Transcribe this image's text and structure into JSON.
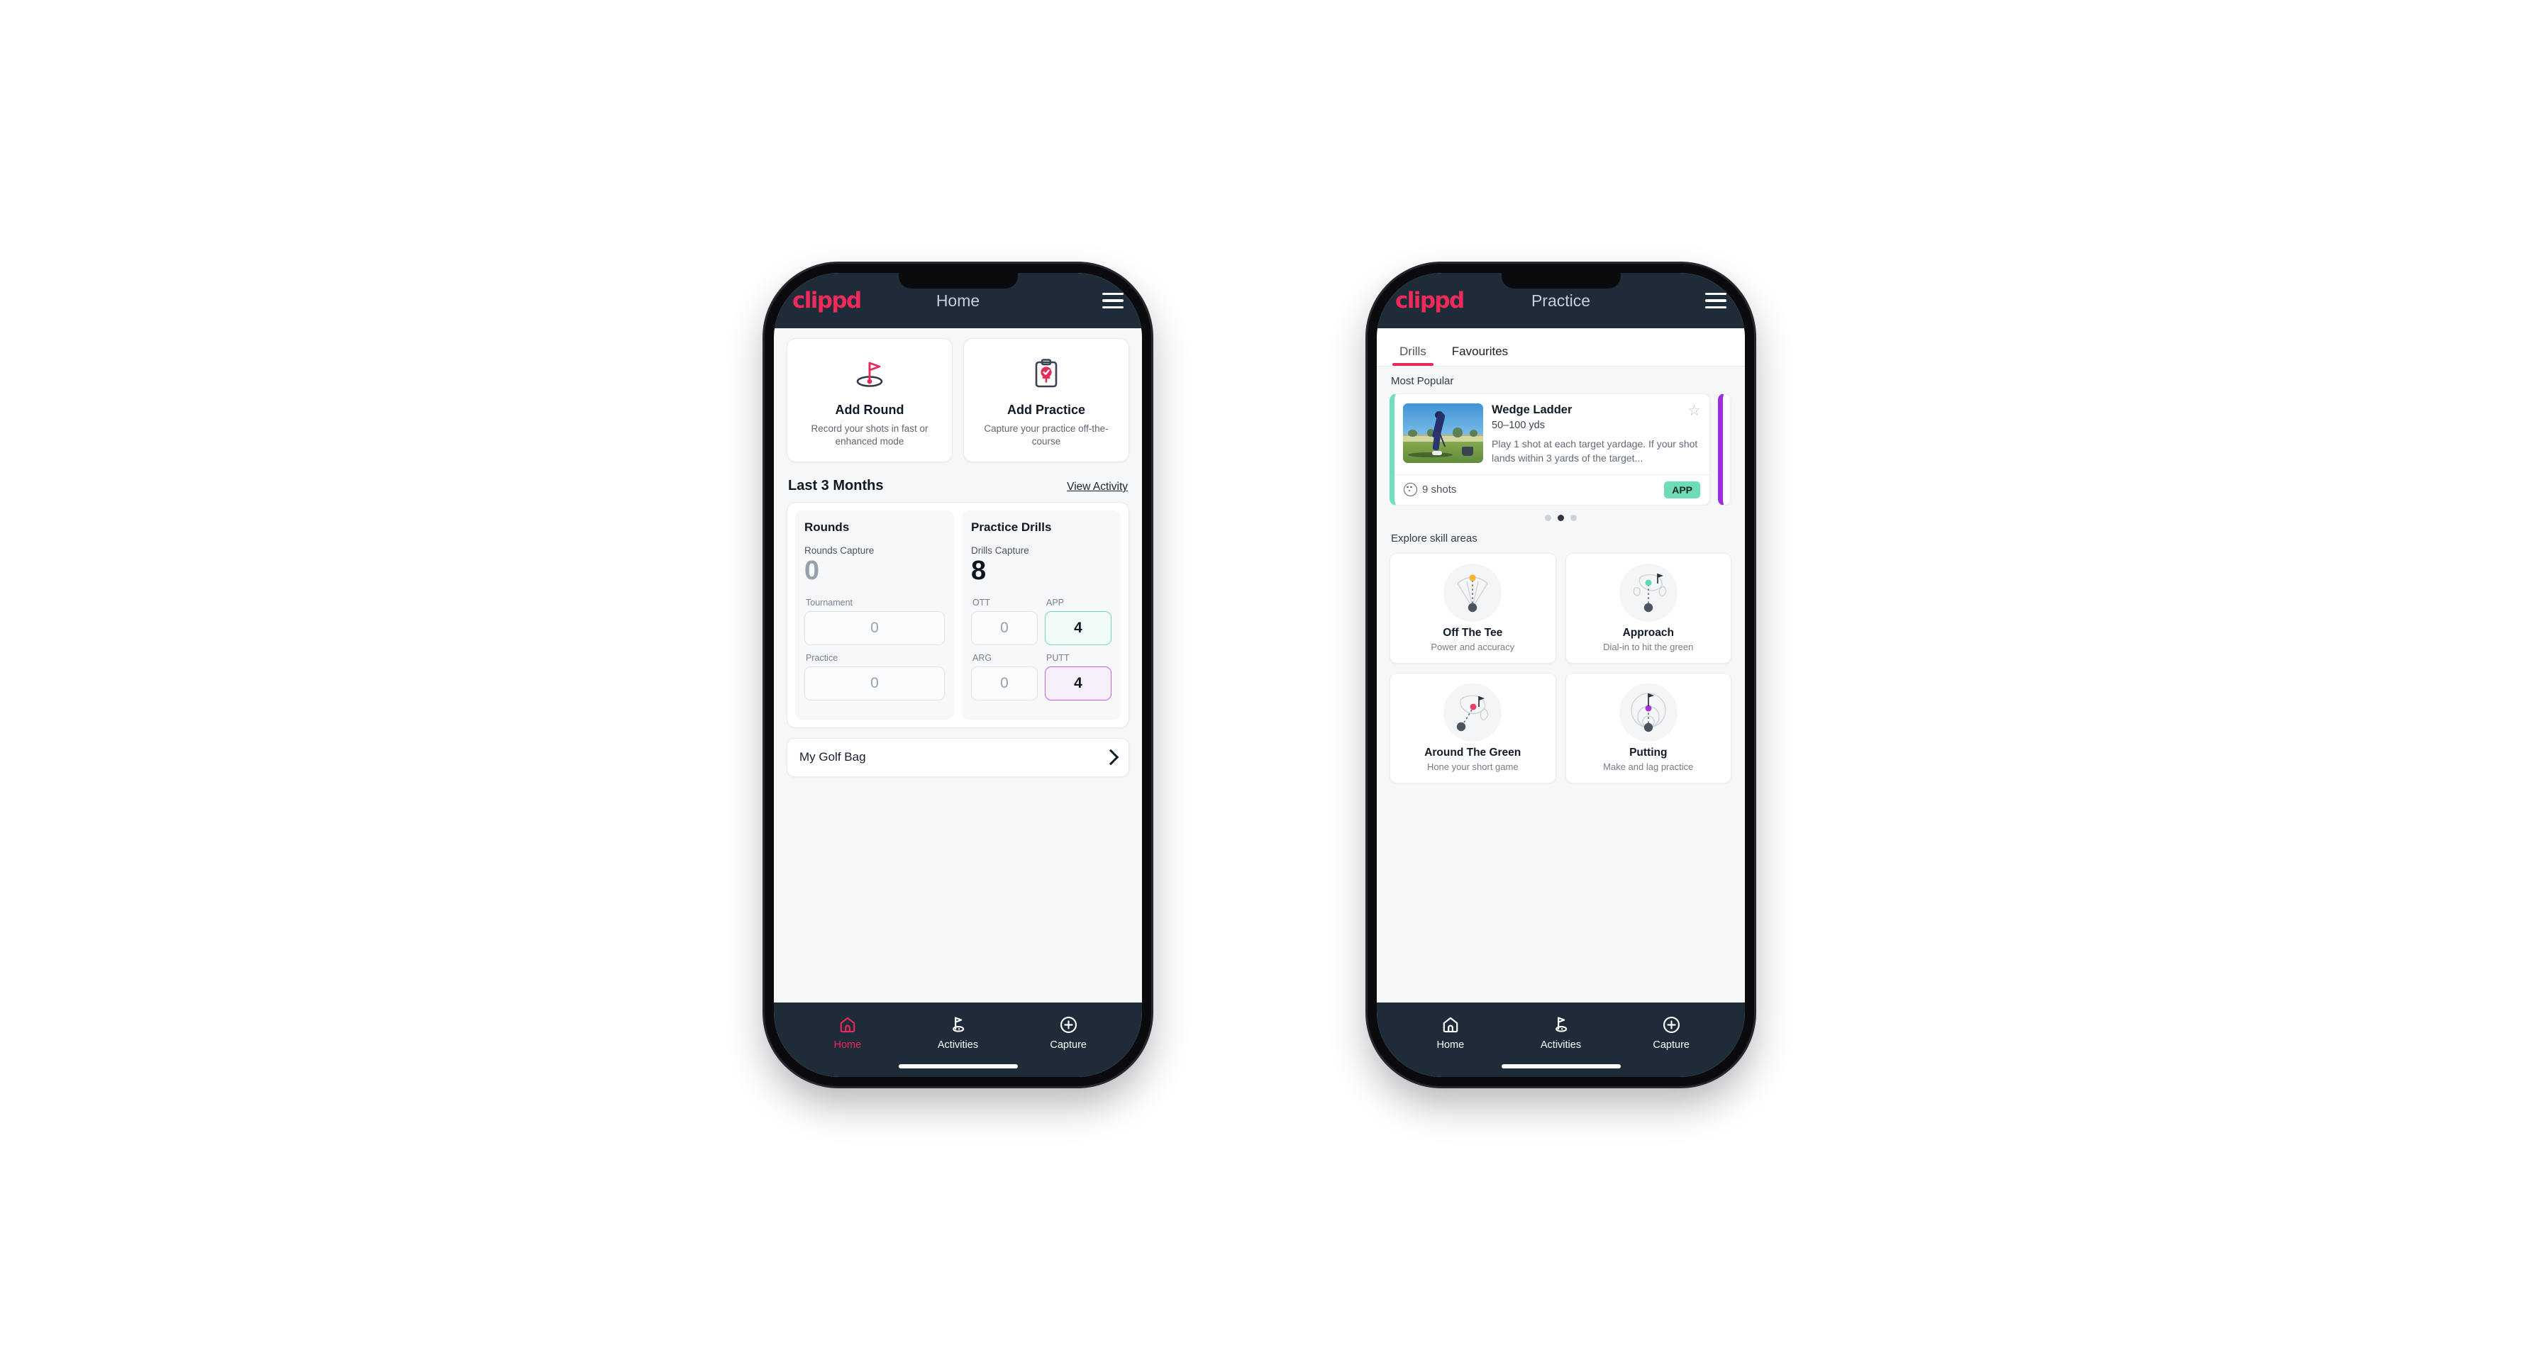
{
  "brand": "clippd",
  "phone_home": {
    "appbar": {
      "title": "Home",
      "menu_icon": "hamburger-menu-icon"
    },
    "quick_actions": [
      {
        "icon": "golf-flag-hole-icon",
        "title": "Add Round",
        "subtitle": "Record your shots in fast or enhanced mode"
      },
      {
        "icon": "clipboard-check-icon",
        "title": "Add Practice",
        "subtitle": "Capture your practice off-the-course"
      }
    ],
    "period": {
      "title": "Last 3 Months",
      "link": "View Activity"
    },
    "stats": {
      "rounds": {
        "heading": "Rounds",
        "capture_label": "Rounds Capture",
        "capture_value": "0",
        "fields": [
          {
            "label": "Tournament",
            "value": "0",
            "state": "empty"
          },
          {
            "label": "Practice",
            "value": "0",
            "state": "empty"
          }
        ]
      },
      "drills": {
        "heading": "Practice Drills",
        "capture_label": "Drills Capture",
        "capture_value": "8",
        "fields": [
          {
            "label": "OTT",
            "value": "0",
            "state": "empty"
          },
          {
            "label": "APP",
            "value": "4",
            "state": "app"
          },
          {
            "label": "ARG",
            "value": "0",
            "state": "empty"
          },
          {
            "label": "PUTT",
            "value": "4",
            "state": "putt"
          }
        ]
      }
    },
    "golf_bag": {
      "label": "My Golf Bag",
      "chevron_icon": "chevron-right-icon"
    },
    "bottom_nav": [
      {
        "label": "Home",
        "icon": "home-icon",
        "state": "active"
      },
      {
        "label": "Activities",
        "icon": "golf-flag-icon",
        "state": "default"
      },
      {
        "label": "Capture",
        "icon": "plus-circle-icon",
        "state": "default"
      }
    ]
  },
  "phone_practice": {
    "appbar": {
      "title": "Practice",
      "menu_icon": "hamburger-menu-icon"
    },
    "tabs": [
      {
        "label": "Drills",
        "active": true
      },
      {
        "label": "Favourites",
        "active": false
      }
    ],
    "most_popular_label": "Most Popular",
    "drill": {
      "title": "Wedge Ladder",
      "yardage": "50–100 yds",
      "description": "Play 1 shot at each target yardage. If your shot lands within 3 yards of the target...",
      "shots": "9 shots",
      "shots_icon": "golf-ball-icon",
      "tag": "APP",
      "star_icon": "star-outline-icon",
      "accent": "#6ee0bd",
      "next_accent": "#9d2ee0",
      "thumbnail_alt": "golfer-hitting-wedge-photo"
    },
    "carousel_dots": {
      "count": 3,
      "active_index": 1
    },
    "skill_label": "Explore skill areas",
    "skills": [
      {
        "name": "Off The Tee",
        "sub": "Power and accuracy",
        "icon": "tee-shot-fan-icon",
        "dot": "#f5b731"
      },
      {
        "name": "Approach",
        "sub": "Dial-in to hit the green",
        "icon": "approach-green-icon",
        "dot": "#5fd9b5"
      },
      {
        "name": "Around The Green",
        "sub": "Hone your short game",
        "icon": "chip-green-icon",
        "dot": "#ef3f63"
      },
      {
        "name": "Putting",
        "sub": "Make and lag practice",
        "icon": "putting-rings-icon",
        "dot": "#a734d6"
      }
    ],
    "bottom_nav": [
      {
        "label": "Home",
        "icon": "home-icon",
        "state": "default"
      },
      {
        "label": "Activities",
        "icon": "golf-flag-icon",
        "state": "default"
      },
      {
        "label": "Capture",
        "icon": "plus-circle-icon",
        "state": "default"
      }
    ]
  },
  "colors": {
    "brand_pink": "#e8295a",
    "appbar_dark": "#1e2b38",
    "app_green": "#6fdcb9",
    "putt_purple": "#b566e0"
  }
}
